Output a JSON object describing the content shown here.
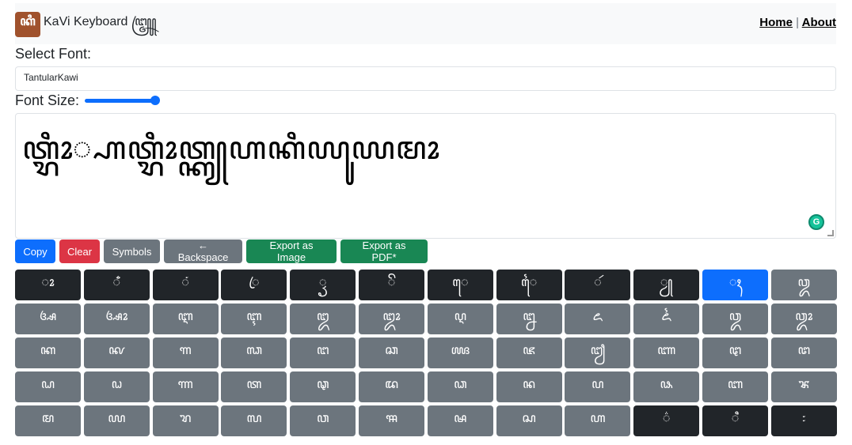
{
  "navbar": {
    "logo_text": "ꦏꦶ",
    "brand": "KaVi Keyboard ꧅",
    "links": {
      "home": "Home",
      "separator": "|",
      "about": "About"
    }
  },
  "font_select": {
    "label": "Select Font:",
    "value": "TantularKawi"
  },
  "font_size": {
    "label": "Font Size:",
    "value_fraction": 0.9
  },
  "editor": {
    "text": "ꦠ꧀ꦫꦶꦴ꧀ꦲꦠ꧀ꦫꦶꦴꦠ꧀ꦏꦾꦲꦏꦶꦪꦸꦪꦩꦴ",
    "grammarly_badge": "G"
  },
  "toolbar": {
    "copy": "Copy",
    "clear": "Clear",
    "symbols": "Symbols",
    "backspace": "← Backspace",
    "export_image": "Export as Image",
    "export_pdf": "Export as PDF*"
  },
  "keys": [
    {
      "label": "ꦴ",
      "style": "dark"
    },
    {
      "label": "ꦀ",
      "style": "dark"
    },
    {
      "label": "ꦁ",
      "style": "dark"
    },
    {
      "label": "ꦿ",
      "style": "dark"
    },
    {
      "label": "ꦽ",
      "style": "dark"
    },
    {
      "label": "ꦼ",
      "style": "dark"
    },
    {
      "label": "ꦺ",
      "style": "dark"
    },
    {
      "label": "ꦻ",
      "style": "dark"
    },
    {
      "label": "ꦂ",
      "style": "dark"
    },
    {
      "label": "ꦾ",
      "style": "dark"
    },
    {
      "label": "ꦃ",
      "style": "active"
    },
    {
      "label": "ꦎ",
      "style": "gray"
    },
    {
      "label": "ꦄ",
      "style": "gray"
    },
    {
      "label": "ꦄꦴ",
      "style": "gray"
    },
    {
      "label": "ꦆ",
      "style": "gray"
    },
    {
      "label": "ꦇ",
      "style": "gray"
    },
    {
      "label": "ꦈ",
      "style": "gray"
    },
    {
      "label": "ꦈꦴ",
      "style": "gray"
    },
    {
      "label": "ꦉ",
      "style": "gray"
    },
    {
      "label": "ꦊ",
      "style": "gray"
    },
    {
      "label": "ꦌ",
      "style": "gray"
    },
    {
      "label": "ꦍ",
      "style": "gray"
    },
    {
      "label": "ꦎ",
      "style": "gray"
    },
    {
      "label": "ꦎꦴ",
      "style": "gray"
    },
    {
      "label": "ꦏ",
      "style": "gray"
    },
    {
      "label": "ꦑ",
      "style": "gray"
    },
    {
      "label": "ꦒ",
      "style": "gray"
    },
    {
      "label": "ꦓ",
      "style": "gray"
    },
    {
      "label": "ꦔ",
      "style": "gray"
    },
    {
      "label": "ꦕ",
      "style": "gray"
    },
    {
      "label": "ꦖ",
      "style": "gray"
    },
    {
      "label": "ꦗ",
      "style": "gray"
    },
    {
      "label": "ꦙ",
      "style": "gray"
    },
    {
      "label": "ꦚ",
      "style": "gray"
    },
    {
      "label": "ꦛ",
      "style": "gray"
    },
    {
      "label": "ꦜ",
      "style": "gray"
    },
    {
      "label": "ꦝ",
      "style": "gray"
    },
    {
      "label": "ꦞ",
      "style": "gray"
    },
    {
      "label": "ꦟ",
      "style": "gray"
    },
    {
      "label": "ꦠ",
      "style": "gray"
    },
    {
      "label": "ꦡ",
      "style": "gray"
    },
    {
      "label": "ꦢ",
      "style": "gray"
    },
    {
      "label": "ꦣ",
      "style": "gray"
    },
    {
      "label": "ꦤ",
      "style": "gray"
    },
    {
      "label": "ꦥ",
      "style": "gray"
    },
    {
      "label": "ꦦ",
      "style": "gray"
    },
    {
      "label": "ꦧ",
      "style": "gray"
    },
    {
      "label": "ꦨ",
      "style": "gray"
    },
    {
      "label": "ꦩ",
      "style": "gray"
    },
    {
      "label": "ꦪ",
      "style": "gray"
    },
    {
      "label": "ꦫ",
      "style": "gray"
    },
    {
      "label": "ꦭ",
      "style": "gray"
    },
    {
      "label": "ꦮ",
      "style": "gray"
    },
    {
      "label": "ꦯ",
      "style": "gray"
    },
    {
      "label": "ꦰ",
      "style": "gray"
    },
    {
      "label": "ꦱ",
      "style": "gray"
    },
    {
      "label": "ꦲ",
      "style": "gray"
    },
    {
      "label": "꦳",
      "style": "dark"
    },
    {
      "label": "ꦶ",
      "style": "dark"
    },
    {
      "label": "꧇",
      "style": "dark"
    }
  ]
}
